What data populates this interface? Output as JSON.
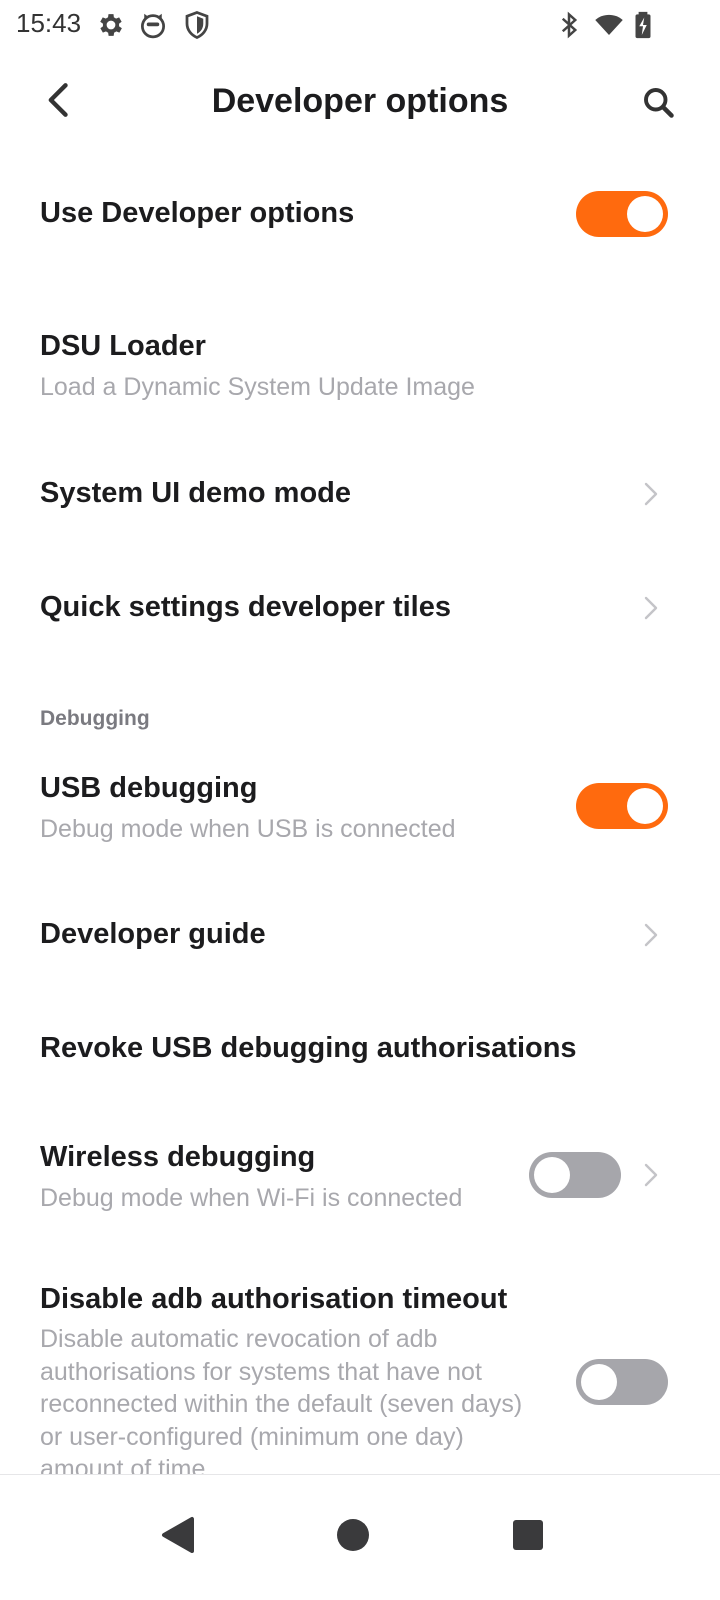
{
  "status_bar": {
    "time": "15:43",
    "left_icons": [
      "gear-icon",
      "cat-face-icon",
      "shield-icon"
    ],
    "right_icons": [
      "bluetooth-icon",
      "wifi-icon",
      "battery-charging-icon"
    ]
  },
  "app_bar": {
    "title": "Developer options",
    "back_icon": "back-chevron-icon",
    "search_icon": "search-icon"
  },
  "accent_color": "#ff6a0e",
  "items": {
    "use_developer_options": {
      "title": "Use Developer options",
      "toggle": "on"
    },
    "dsu_loader": {
      "title": "DSU Loader",
      "subtitle": "Load a Dynamic System Update Image"
    },
    "system_ui_demo": {
      "title": "System UI demo mode"
    },
    "quick_settings_tiles": {
      "title": "Quick settings developer tiles"
    },
    "debugging_header": "Debugging",
    "usb_debugging": {
      "title": "USB debugging",
      "subtitle": "Debug mode when USB is connected",
      "toggle": "on"
    },
    "developer_guide": {
      "title": "Developer guide"
    },
    "revoke_usb": {
      "title": "Revoke USB debugging authorisations"
    },
    "wireless_debugging": {
      "title": "Wireless debugging",
      "subtitle": "Debug mode when Wi-Fi is connected",
      "toggle": "off"
    },
    "disable_adb_timeout": {
      "title": "Disable adb authorisation timeout",
      "subtitle": "Disable automatic revocation of adb authorisations for systems that have not reconnected within the default (seven days) or user-configured (minimum one day) amount of time.",
      "toggle": "off"
    }
  },
  "nav_bar": {
    "back_icon": "nav-back-triangle-icon",
    "home_icon": "nav-home-circle-icon",
    "recents_icon": "nav-recents-square-icon"
  }
}
